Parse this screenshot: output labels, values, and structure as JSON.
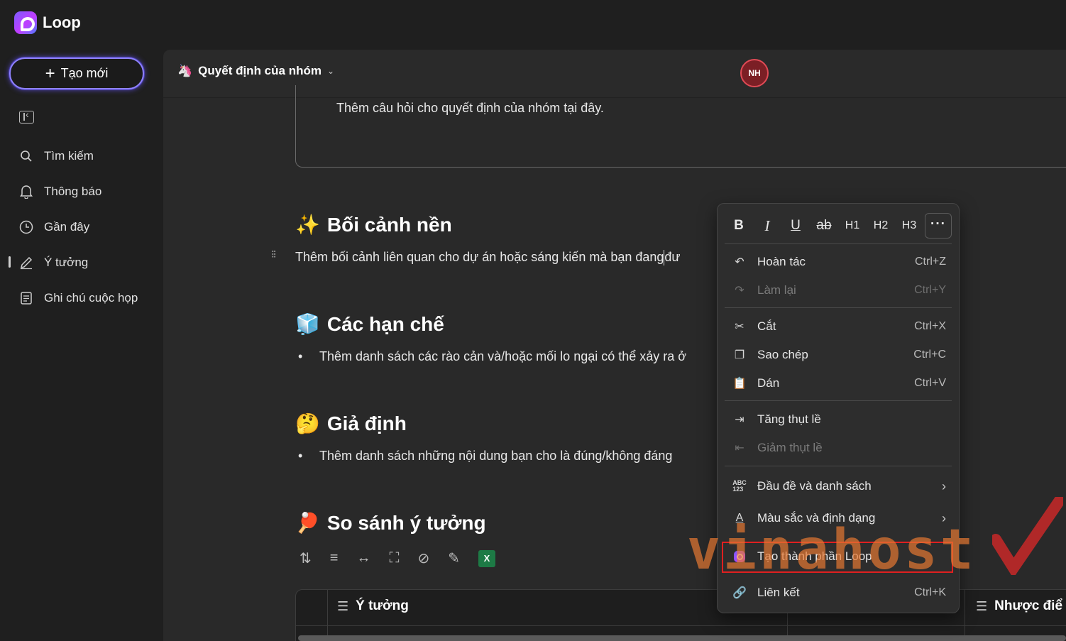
{
  "app": {
    "name": "Loop"
  },
  "sidebar": {
    "new_button": "Tạo mới",
    "items": [
      {
        "label": "Tìm kiếm",
        "icon": "search-icon"
      },
      {
        "label": "Thông báo",
        "icon": "bell-icon"
      },
      {
        "label": "Gần đây",
        "icon": "clock-icon"
      },
      {
        "label": "Ý tưởng",
        "icon": "pen-icon"
      },
      {
        "label": "Ghi chú cuộc họp",
        "icon": "notes-icon"
      }
    ]
  },
  "header": {
    "doc_title": "Quyết định của nhóm",
    "avatar_initials": "NH"
  },
  "content": {
    "question_placeholder": "Thêm câu hỏi cho quyết định của nhóm tại đây.",
    "sections": [
      {
        "emoji": "✨",
        "title": "Bối cảnh nền",
        "text_before_caret": "Thêm bối cảnh liên quan cho dự án hoặc sáng kiến mà bạn đang",
        "text_after_caret": "đư"
      },
      {
        "emoji": "🧊",
        "title": "Các hạn chế",
        "bullet": "Thêm danh sách các rào cản và/hoặc mối lo ngại có thể xảy ra ở"
      },
      {
        "emoji": "🤔",
        "title": "Giả định",
        "bullet": "Thêm danh sách những nội dung bạn cho là đúng/không đáng"
      },
      {
        "emoji": "🏓",
        "title": "So sánh ý tưởng"
      }
    ],
    "table": {
      "columns": [
        "Ý tưởng",
        "Nhược điể"
      ]
    }
  },
  "context_menu": {
    "format_bar": [
      "B",
      "I",
      "U",
      "ab",
      "H1",
      "H2",
      "H3",
      "···"
    ],
    "items": [
      {
        "label": "Hoàn tác",
        "shortcut": "Ctrl+Z",
        "icon": "undo-icon",
        "disabled": false
      },
      {
        "label": "Làm lại",
        "shortcut": "Ctrl+Y",
        "icon": "redo-icon",
        "disabled": true
      },
      {
        "label": "Cắt",
        "shortcut": "Ctrl+X",
        "icon": "scissors-icon",
        "disabled": false
      },
      {
        "label": "Sao chép",
        "shortcut": "Ctrl+C",
        "icon": "copy-icon",
        "disabled": false
      },
      {
        "label": "Dán",
        "shortcut": "Ctrl+V",
        "icon": "paste-icon",
        "disabled": false
      },
      {
        "label": "Tăng thụt lề",
        "shortcut": "",
        "icon": "indent-icon",
        "disabled": false
      },
      {
        "label": "Giảm thụt lề",
        "shortcut": "",
        "icon": "outdent-icon",
        "disabled": true
      },
      {
        "label": "Đầu đề và danh sách",
        "shortcut": "",
        "icon": "abc-icon",
        "disabled": false
      },
      {
        "label": "Màu sắc và định dạng",
        "shortcut": "",
        "icon": "text-color-icon",
        "disabled": false
      },
      {
        "label": "Tạo thành phần Loop",
        "shortcut": "",
        "icon": "loop-icon",
        "disabled": false
      },
      {
        "label": "Liên kết",
        "shortcut": "Ctrl+K",
        "icon": "link-icon",
        "disabled": false
      }
    ]
  },
  "watermark": {
    "text": "vinahost"
  },
  "colors": {
    "accent": "#8f82ff",
    "highlight": "#e02020",
    "avatar": "#7b1f25"
  }
}
